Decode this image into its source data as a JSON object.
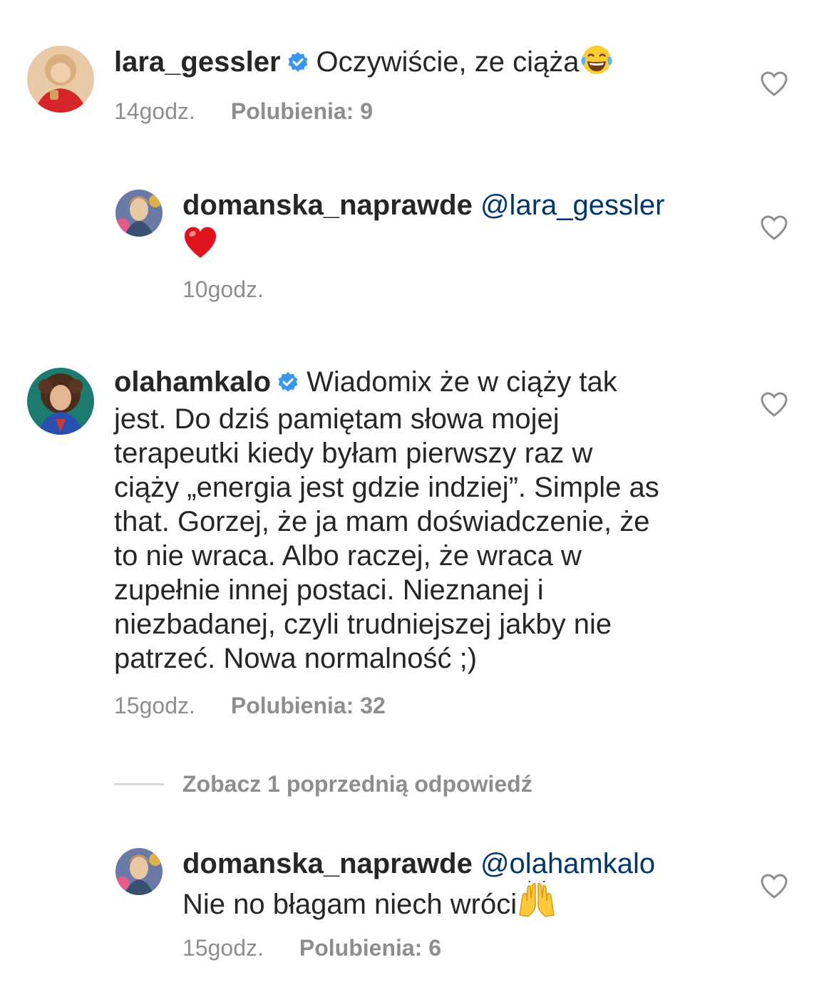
{
  "comments": [
    {
      "username": "lara_gessler",
      "verified": true,
      "text": "Oczywiście, ze ciąża",
      "emoji": "tears-of-joy",
      "time": "14godz.",
      "likes": "Polubienia: 9",
      "avatar_icon": "avatar-lara-gessler"
    },
    {
      "username": "domanska_naprawde",
      "mention": "@lara_gessler",
      "emoji": "red-heart",
      "time": "10godz.",
      "avatar_icon": "avatar-domanska-naprawde"
    },
    {
      "username": "olahamkalo",
      "verified": true,
      "lines": [
        "Wiadomix że w ciąży tak",
        "jest. Do dziś pamiętam słowa mojej",
        "terapeutki kiedy byłam pierwszy raz w",
        "ciąży „energia jest gdzie indziej”. Simple as",
        "that. Gorzej, że ja mam doświadczenie, że",
        "to nie wraca. Albo raczej, że wraca w",
        "zupełnie innej postaci. Nieznanej i",
        "niezbadanej, czyli trudniejszej jakby nie",
        "patrzeć. Nowa normalność ;)"
      ],
      "time": "15godz.",
      "likes": "Polubienia: 32",
      "avatar_icon": "avatar-olahamkalo"
    },
    {
      "username": "domanska_naprawde",
      "mention": "@olahamkalo",
      "text": "Nie no błagam niech wróci",
      "emoji": "raising-hands",
      "time": "15godz.",
      "likes": "Polubienia: 6",
      "avatar_icon": "avatar-domanska-naprawde"
    }
  ],
  "view_replies_label": "Zobacz 1 poprzednią odpowiedź",
  "colors": {
    "text": "#262626",
    "secondary": "#8e8e8e",
    "mention": "#00376b",
    "verified": "#3897f0"
  }
}
